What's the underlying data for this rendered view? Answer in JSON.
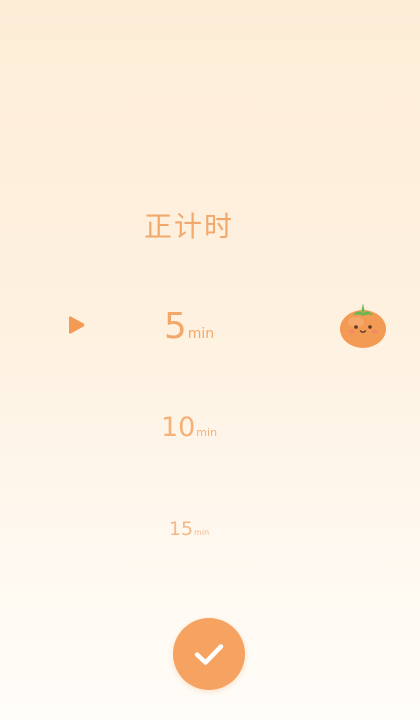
{
  "picker": {
    "title": "正计时",
    "options": [
      {
        "value": "5",
        "unit": "min",
        "selected": true
      },
      {
        "value": "10",
        "unit": "min",
        "selected": false
      },
      {
        "value": "15",
        "unit": "min",
        "selected": false
      }
    ]
  },
  "icons": {
    "indicator": "play-triangle-icon",
    "mascot": "tomato-mascot-icon",
    "confirm": "check-icon"
  },
  "colors": {
    "accent": "#F3A86B",
    "button": "#F6A260",
    "tomato": "#F39A55",
    "leaf": "#6FB552",
    "background_top": "#FDEDD7",
    "background_bottom": "#FFFDF9"
  }
}
